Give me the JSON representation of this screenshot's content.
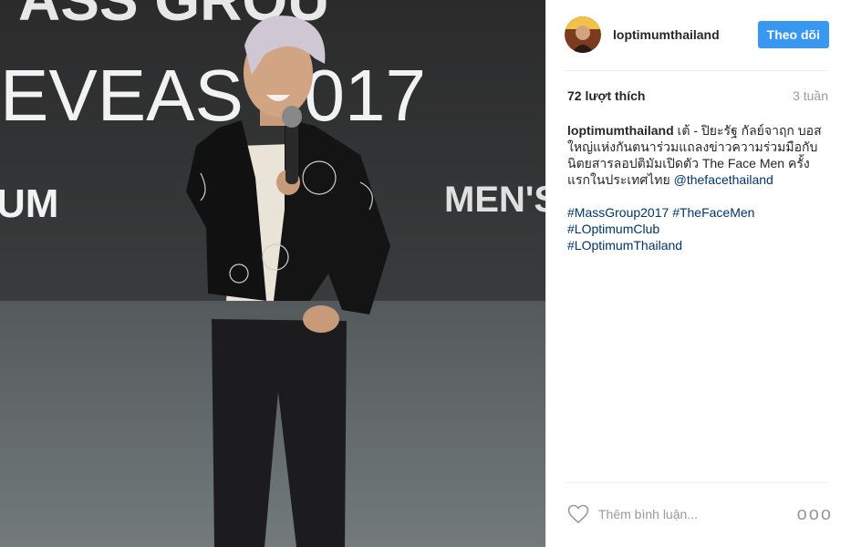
{
  "photo": {
    "backdrop_text_top": "ASS GROU",
    "backdrop_text_main": "EVEAS 2017",
    "backdrop_text_right": "MEN'S FI",
    "backdrop_text_left": "UM"
  },
  "post": {
    "username": "loptimumthailand",
    "follow_label": "Theo dõi",
    "likes": "72 lượt thích",
    "time_ago": "3 tuần",
    "caption_user": "loptimumthailand",
    "caption_text": " เต้ - ปิยะรัฐ กัลย์จาฤก บอสใหญ่แห่งกันตนาร่วมแถลงข่าวความร่วมมือกับนิตยสารลอปติมัมเปิดตัว The Face Men ครั้งแรกในประเทศไทย ",
    "caption_mention": "@thefacethailand",
    "hashtags": [
      "#MassGroup2017",
      "#TheFaceMen",
      "#LOptimumClub",
      "#LOptimumThailand"
    ],
    "comment_placeholder": "Thêm bình luận...",
    "more_label": "ooo"
  }
}
